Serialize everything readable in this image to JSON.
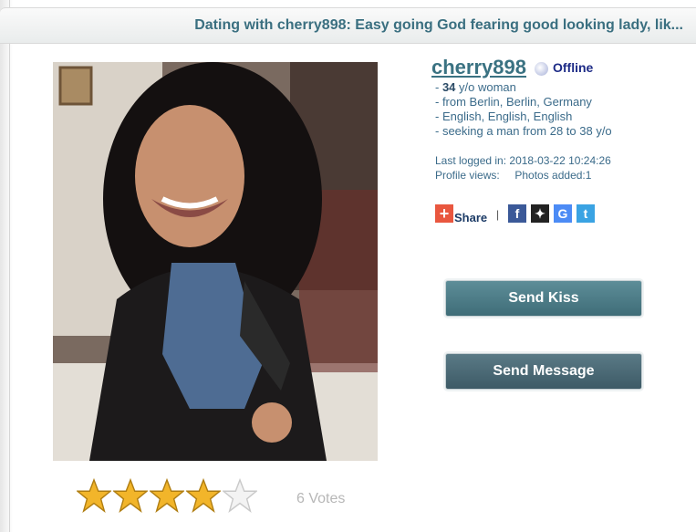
{
  "header": {
    "title": "Dating with cherry898: Easy going God fearing good looking lady, lik..."
  },
  "profile": {
    "username": "cherry898",
    "status": "Offline",
    "age_prefix": "- ",
    "age": "34",
    "age_suffix": " y/o woman",
    "location": "- from Berlin, Berlin, Germany",
    "languages": "- English, English, English",
    "seeking": "- seeking a man from 28 to 38 y/o",
    "last_logged": "Last logged in: 2018-03-22 10:24:26",
    "profile_views": "Profile views:",
    "photos_added": "Photos added:1"
  },
  "share": {
    "label": "Share",
    "separator": "|",
    "networks": [
      {
        "icon": "facebook-icon",
        "glyph": "f",
        "color": "#3b5998"
      },
      {
        "icon": "myspace-icon",
        "glyph": "✦",
        "color": "#222222"
      },
      {
        "icon": "google-icon",
        "glyph": "G",
        "color": "#4c8bf5"
      },
      {
        "icon": "twitter-icon",
        "glyph": "t",
        "color": "#3aa3e3"
      }
    ]
  },
  "actions": {
    "send_kiss": "Send Kiss",
    "send_message": "Send Message"
  },
  "rating": {
    "value": 4,
    "max": 5,
    "votes_label": "6 Votes"
  }
}
